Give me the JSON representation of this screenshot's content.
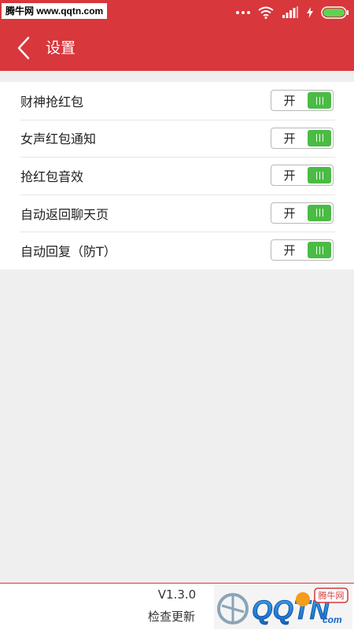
{
  "status_bar": {
    "watermark": "腾牛网 www.qqtn.com",
    "icons": [
      "more-dots-icon",
      "wifi-icon",
      "signal-icon",
      "charging-icon",
      "battery-icon"
    ]
  },
  "app_bar": {
    "title": "设置",
    "back_icon": "chevron-left-icon"
  },
  "settings": [
    {
      "label": "财神抢红包",
      "toggle_label": "开",
      "on": true
    },
    {
      "label": "女声红包通知",
      "toggle_label": "开",
      "on": true
    },
    {
      "label": "抢红包音效",
      "toggle_label": "开",
      "on": true
    },
    {
      "label": "自动返回聊天页",
      "toggle_label": "开",
      "on": true
    },
    {
      "label": "自动回复（防T）",
      "toggle_label": "开",
      "on": true
    }
  ],
  "footer": {
    "version": "V1.3.0",
    "update_label": "检查更新",
    "logo_text": "QQTN",
    "logo_badge": "腾牛网",
    "logo_suffix": "com"
  },
  "colors": {
    "primary": "#d8373c",
    "toggle_on": "#4bbb45",
    "background": "#efefef"
  }
}
